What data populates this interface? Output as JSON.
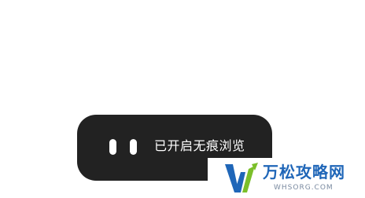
{
  "toast": {
    "message": "已开启无痕浏览",
    "icon": "incognito-icon"
  },
  "watermark": {
    "title": "万松攻略网",
    "subtitle": "WHSORG.COM",
    "logo_icon": "w-logo-icon",
    "colors": {
      "brand_blue": "#1f66b8",
      "brand_green": "#7bbf2a"
    }
  },
  "colors": {
    "toast_background": "#222222",
    "toast_text": "#ffffff",
    "page_background": "#ffffff"
  }
}
